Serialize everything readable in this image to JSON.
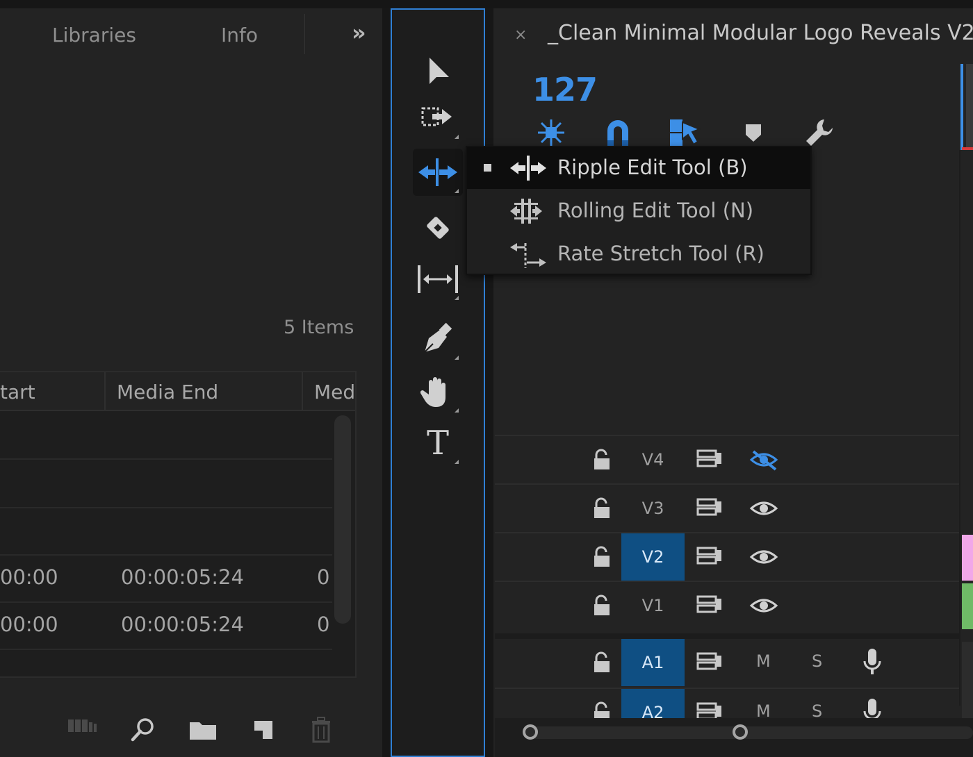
{
  "project_panel": {
    "tabs": [
      {
        "label": "Libraries"
      },
      {
        "label": "Info"
      }
    ],
    "overflow_label": "»",
    "items_count": "5 Items",
    "columns": [
      "tart",
      "Media End",
      "Med"
    ],
    "rows": [
      {
        "start": "",
        "end": "",
        "dur": ""
      },
      {
        "start": "",
        "end": "",
        "dur": ""
      },
      {
        "start": "",
        "end": "",
        "dur": ""
      },
      {
        "start": "00:00",
        "end": "00:00:05:24",
        "dur": "0"
      },
      {
        "start": "00:00",
        "end": "00:00:05:24",
        "dur": "0"
      }
    ],
    "bottom_icons": [
      "freeform-view-icon",
      "search-icon",
      "folder-icon",
      "new-item-icon",
      "trash-icon"
    ]
  },
  "tools": {
    "items": [
      {
        "name": "selection-tool",
        "icon": "arrow-icon"
      },
      {
        "name": "track-select-tool",
        "icon": "track-select-icon"
      },
      {
        "name": "ripple-edit-tool",
        "icon": "ripple-edit-icon",
        "selected": true
      },
      {
        "name": "razor-tool",
        "icon": "razor-icon"
      },
      {
        "name": "slip-tool",
        "icon": "slip-icon"
      },
      {
        "name": "pen-tool",
        "icon": "pen-icon"
      },
      {
        "name": "hand-tool",
        "icon": "hand-icon"
      },
      {
        "name": "type-tool",
        "icon": "type-icon"
      }
    ],
    "type_glyph": "T"
  },
  "flyout": {
    "items": [
      {
        "label": "Ripple Edit Tool (B)",
        "selected": true
      },
      {
        "label": "Rolling Edit Tool (N)",
        "selected": false
      },
      {
        "label": "Rate Stretch Tool (R)",
        "selected": false
      }
    ]
  },
  "timeline": {
    "close_label": "×",
    "title": "_Clean Minimal Modular Logo Reveals V2",
    "timecode": "127",
    "accent": "#3d8fe6",
    "toolbar_icons": [
      "nest-icon",
      "snap-magnet-icon",
      "linked-selection-icon",
      "marker-icon",
      "wrench-icon"
    ],
    "video_tracks": [
      {
        "name": "V4",
        "target": false,
        "visible": false
      },
      {
        "name": "V3",
        "target": false,
        "visible": true
      },
      {
        "name": "V2",
        "target": true,
        "visible": true
      },
      {
        "name": "V1",
        "target": false,
        "visible": true
      }
    ],
    "audio_tracks": [
      {
        "name": "A1",
        "target": true,
        "m": "M",
        "s": "S"
      },
      {
        "name": "A2",
        "target": true,
        "m": "M",
        "s": "S"
      }
    ],
    "clip_colors": {
      "v2": "#f1a7e9",
      "v1": "#6fba67"
    }
  }
}
